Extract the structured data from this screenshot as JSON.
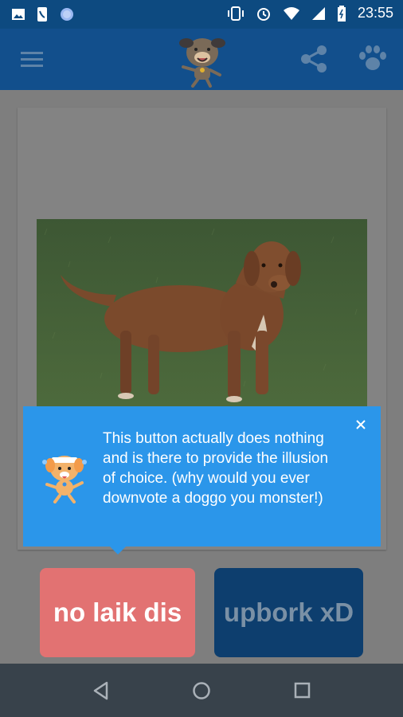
{
  "status_bar": {
    "time": "23:55"
  },
  "tooltip": {
    "text": "This button actually does nothing and is there to provide the illusion of choice. (why would you ever downvote a doggo you monster!)"
  },
  "buttons": {
    "downvote_label": "no laik dis",
    "upvote_label": "upbork xD"
  },
  "icons": {
    "status_left": [
      "image-icon",
      "phone-icon",
      "circle-icon"
    ],
    "status_right": [
      "vibrate-icon",
      "alarm-icon",
      "wifi-icon",
      "signal-icon",
      "battery-icon"
    ],
    "appbar": [
      "hamburger-menu-icon",
      "dog-logo-icon",
      "share-icon",
      "paw-icon"
    ],
    "navbar": [
      "back-icon",
      "home-icon",
      "recents-icon"
    ]
  },
  "colors": {
    "appbar": "#124f8c",
    "tooltip": "#2b96ea",
    "downvote": "#e27272",
    "upvote": "#0d3e6e"
  }
}
